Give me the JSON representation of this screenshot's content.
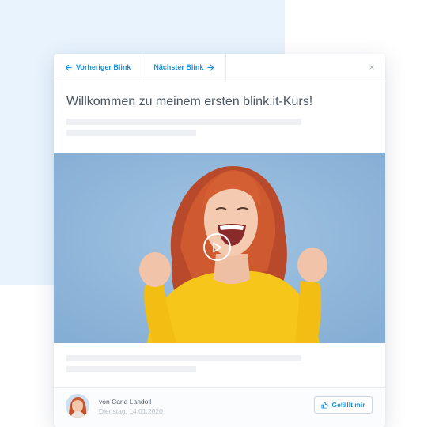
{
  "nav": {
    "prev_label": "Vorheriger Blink",
    "next_label": "Nächster Blink",
    "close_label": "×"
  },
  "lesson": {
    "title": "Willkommen zu meinem ersten blink.it-Kurs!"
  },
  "footer": {
    "author": "von Carla Landoll",
    "date": "Dienstag, 14.01.2020",
    "like_label": "Gefällt mir"
  },
  "icons": {
    "prev": "arrow-left-icon",
    "next": "arrow-right-icon",
    "close": "close-icon",
    "play": "play-icon",
    "like": "thumbs-up-icon"
  },
  "colors": {
    "accent": "#1c8fd6",
    "background_panel": "#e8f3fd",
    "video_background": "#90b7db",
    "shirt": "#f6c61a",
    "hair": "#c9522b"
  }
}
